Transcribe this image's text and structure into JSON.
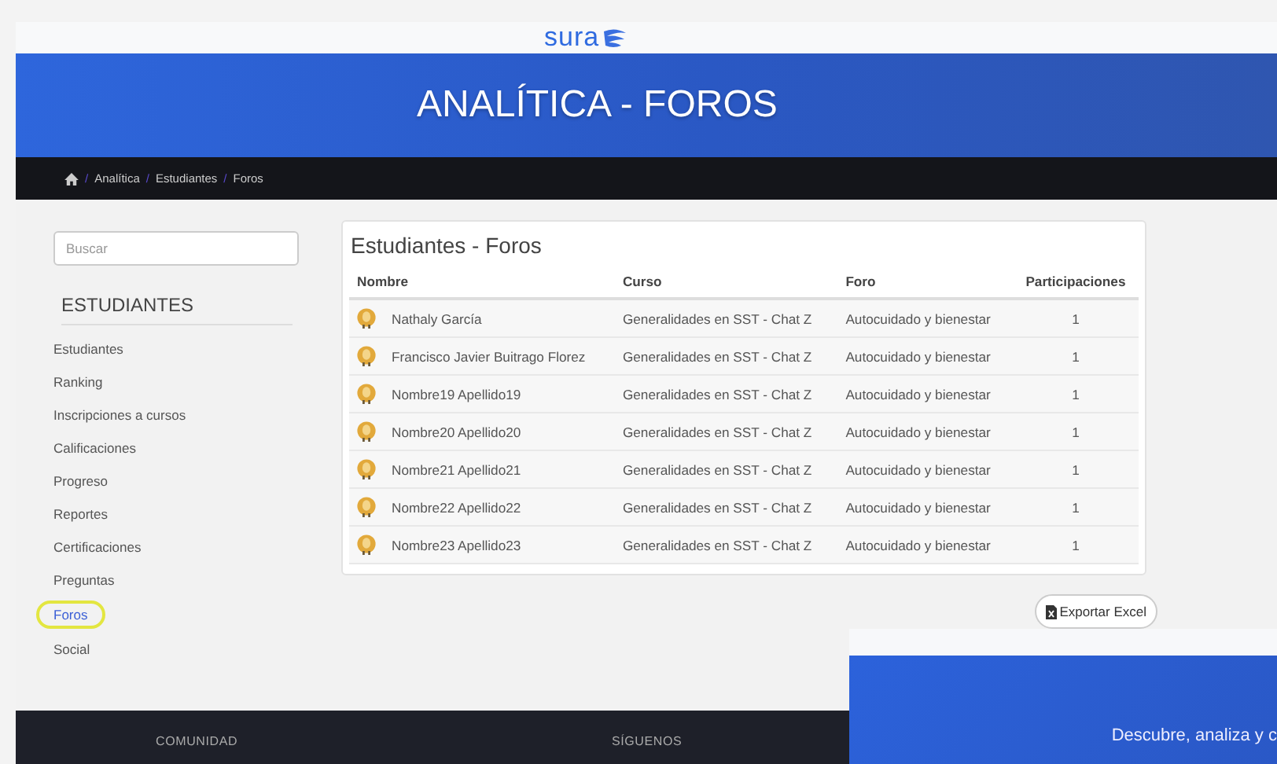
{
  "header": {
    "logo": "sura"
  },
  "banner": {
    "title": "ANALÍTICA - FOROS"
  },
  "breadcrumb": {
    "separator": "/",
    "items": [
      "Analítica",
      "Estudiantes",
      "Foros"
    ]
  },
  "sidebar": {
    "search": {
      "placeholder": "Buscar"
    },
    "heading": "ESTUDIANTES",
    "items": [
      {
        "label": "Estudiantes",
        "selected": false
      },
      {
        "label": "Ranking",
        "selected": false
      },
      {
        "label": "Inscripciones a cursos",
        "selected": false
      },
      {
        "label": "Calificaciones",
        "selected": false
      },
      {
        "label": "Progreso",
        "selected": false
      },
      {
        "label": "Reportes",
        "selected": false
      },
      {
        "label": "Certificaciones",
        "selected": false
      },
      {
        "label": "Preguntas",
        "selected": false
      },
      {
        "label": "Foros",
        "selected": true
      },
      {
        "label": "Social",
        "selected": false
      }
    ]
  },
  "panel": {
    "title": "Estudiantes - Foros",
    "columns": [
      "Nombre",
      "Curso",
      "Foro",
      "Participaciones"
    ],
    "rows": [
      {
        "name": "Nathaly García",
        "course": "Generalidades en SST - Chat Z",
        "forum": "Autocuidado y bienestar",
        "participations": "1"
      },
      {
        "name": "Francisco Javier Buitrago Florez",
        "course": "Generalidades en SST - Chat Z",
        "forum": "Autocuidado y bienestar",
        "participations": "1"
      },
      {
        "name": "Nombre19 Apellido19",
        "course": "Generalidades en SST - Chat Z",
        "forum": "Autocuidado y bienestar",
        "participations": "1"
      },
      {
        "name": "Nombre20 Apellido20",
        "course": "Generalidades en SST - Chat Z",
        "forum": "Autocuidado y bienestar",
        "participations": "1"
      },
      {
        "name": "Nombre21 Apellido21",
        "course": "Generalidades en SST - Chat Z",
        "forum": "Autocuidado y bienestar",
        "participations": "1"
      },
      {
        "name": "Nombre22 Apellido22",
        "course": "Generalidades en SST - Chat Z",
        "forum": "Autocuidado y bienestar",
        "participations": "1"
      },
      {
        "name": "Nombre23 Apellido23",
        "course": "Generalidades en SST - Chat Z",
        "forum": "Autocuidado y bienestar",
        "participations": "1"
      }
    ]
  },
  "export_button": "Exportar Excel",
  "footer": {
    "columns": [
      "COMUNIDAD",
      "SÍGUENOS"
    ]
  },
  "overlay": {
    "text": "Descubre, analiza y c"
  }
}
